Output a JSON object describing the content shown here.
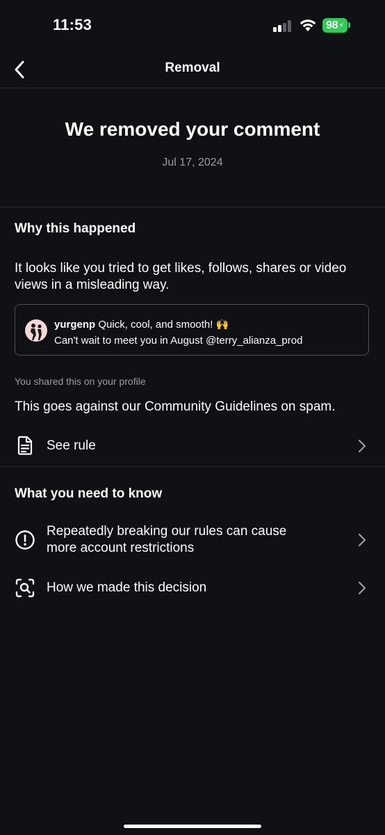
{
  "status_bar": {
    "time": "11:53",
    "battery": "98",
    "battery_color": "#33c759"
  },
  "nav": {
    "title": "Removal",
    "back_icon": "chevron-left-icon"
  },
  "header": {
    "headline": "We removed your comment",
    "date": "Jul 17, 2024"
  },
  "why": {
    "title": "Why this happened",
    "description": "It looks like you tried to get likes, follows, shares or video views in a misleading way.",
    "comment": {
      "username": "yurgenp",
      "text_line1": "Quick, cool, and smooth! 🙌",
      "text_line2": "Can't wait to meet you in August @terry_alianza_prod"
    },
    "shared_note": "You shared this on your profile",
    "guideline_text": "This goes against our Community Guidelines on spam.",
    "see_rule_label": "See rule"
  },
  "need_to_know": {
    "title": "What you need to know",
    "items": [
      {
        "icon": "alert-circle-icon",
        "label_line1": "Repeatedly breaking our rules can cause",
        "label_line2": "more account restrictions"
      },
      {
        "icon": "scan-search-icon",
        "label": "How we made this decision"
      }
    ]
  },
  "colors": {
    "background": "#0f1115",
    "divider": "#24262b",
    "muted_text": "#9a9da3",
    "card_border": "#4a4d53"
  }
}
